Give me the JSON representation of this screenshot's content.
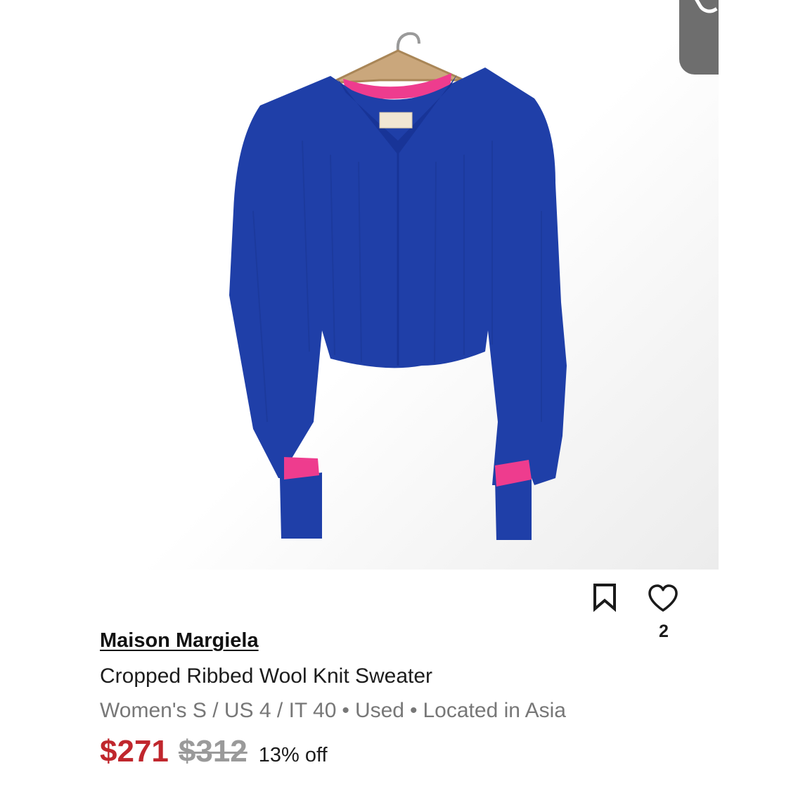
{
  "listing": {
    "brand": "Maison Margiela",
    "title": "Cropped Ribbed Wool Knit Sweater",
    "details": {
      "size": "Women's S / US 4 / IT 40",
      "condition": "Used",
      "location": "Located in Asia",
      "separator": "•"
    },
    "price": "$271",
    "original_price": "$312",
    "discount": "13% off",
    "like_count": "2"
  },
  "icons": {
    "save": "bookmark-icon",
    "like": "heart-icon"
  },
  "colors": {
    "price": "#c0272d",
    "original_price": "#9a9a9a",
    "sweater": "#1f3fa8",
    "accent_pink": "#ee3c8e"
  }
}
